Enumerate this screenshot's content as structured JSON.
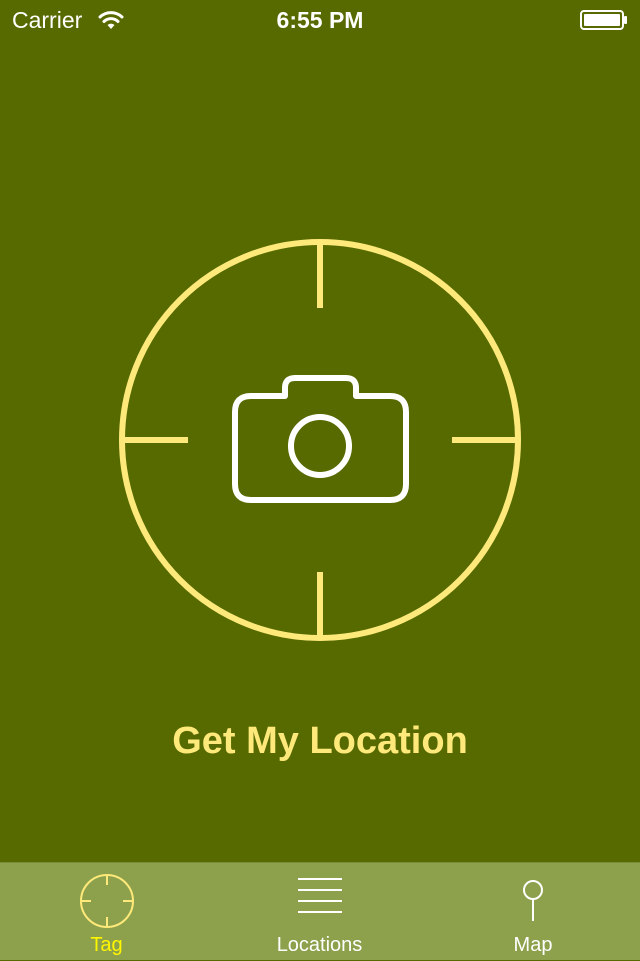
{
  "status_bar": {
    "carrier": "Carrier",
    "wifi_icon": "wifi-icon",
    "time": "6:55 PM",
    "battery_icon": "battery-full-icon"
  },
  "main": {
    "crosshair_icon": "crosshair-icon",
    "camera_icon": "camera-icon",
    "get_location_label": "Get My Location"
  },
  "tab_bar": {
    "tabs": [
      {
        "label": "Tag",
        "icon": "crosshair-icon",
        "active": true
      },
      {
        "label": "Locations",
        "icon": "list-icon",
        "active": false
      },
      {
        "label": "Map",
        "icon": "map-pin-icon",
        "active": false
      }
    ]
  },
  "colors": {
    "background": "#566A00",
    "accent": "#FFE97A",
    "tab_bar": "#8DA14C",
    "active_tab": "#FFF600",
    "white": "#FFFFFF"
  }
}
